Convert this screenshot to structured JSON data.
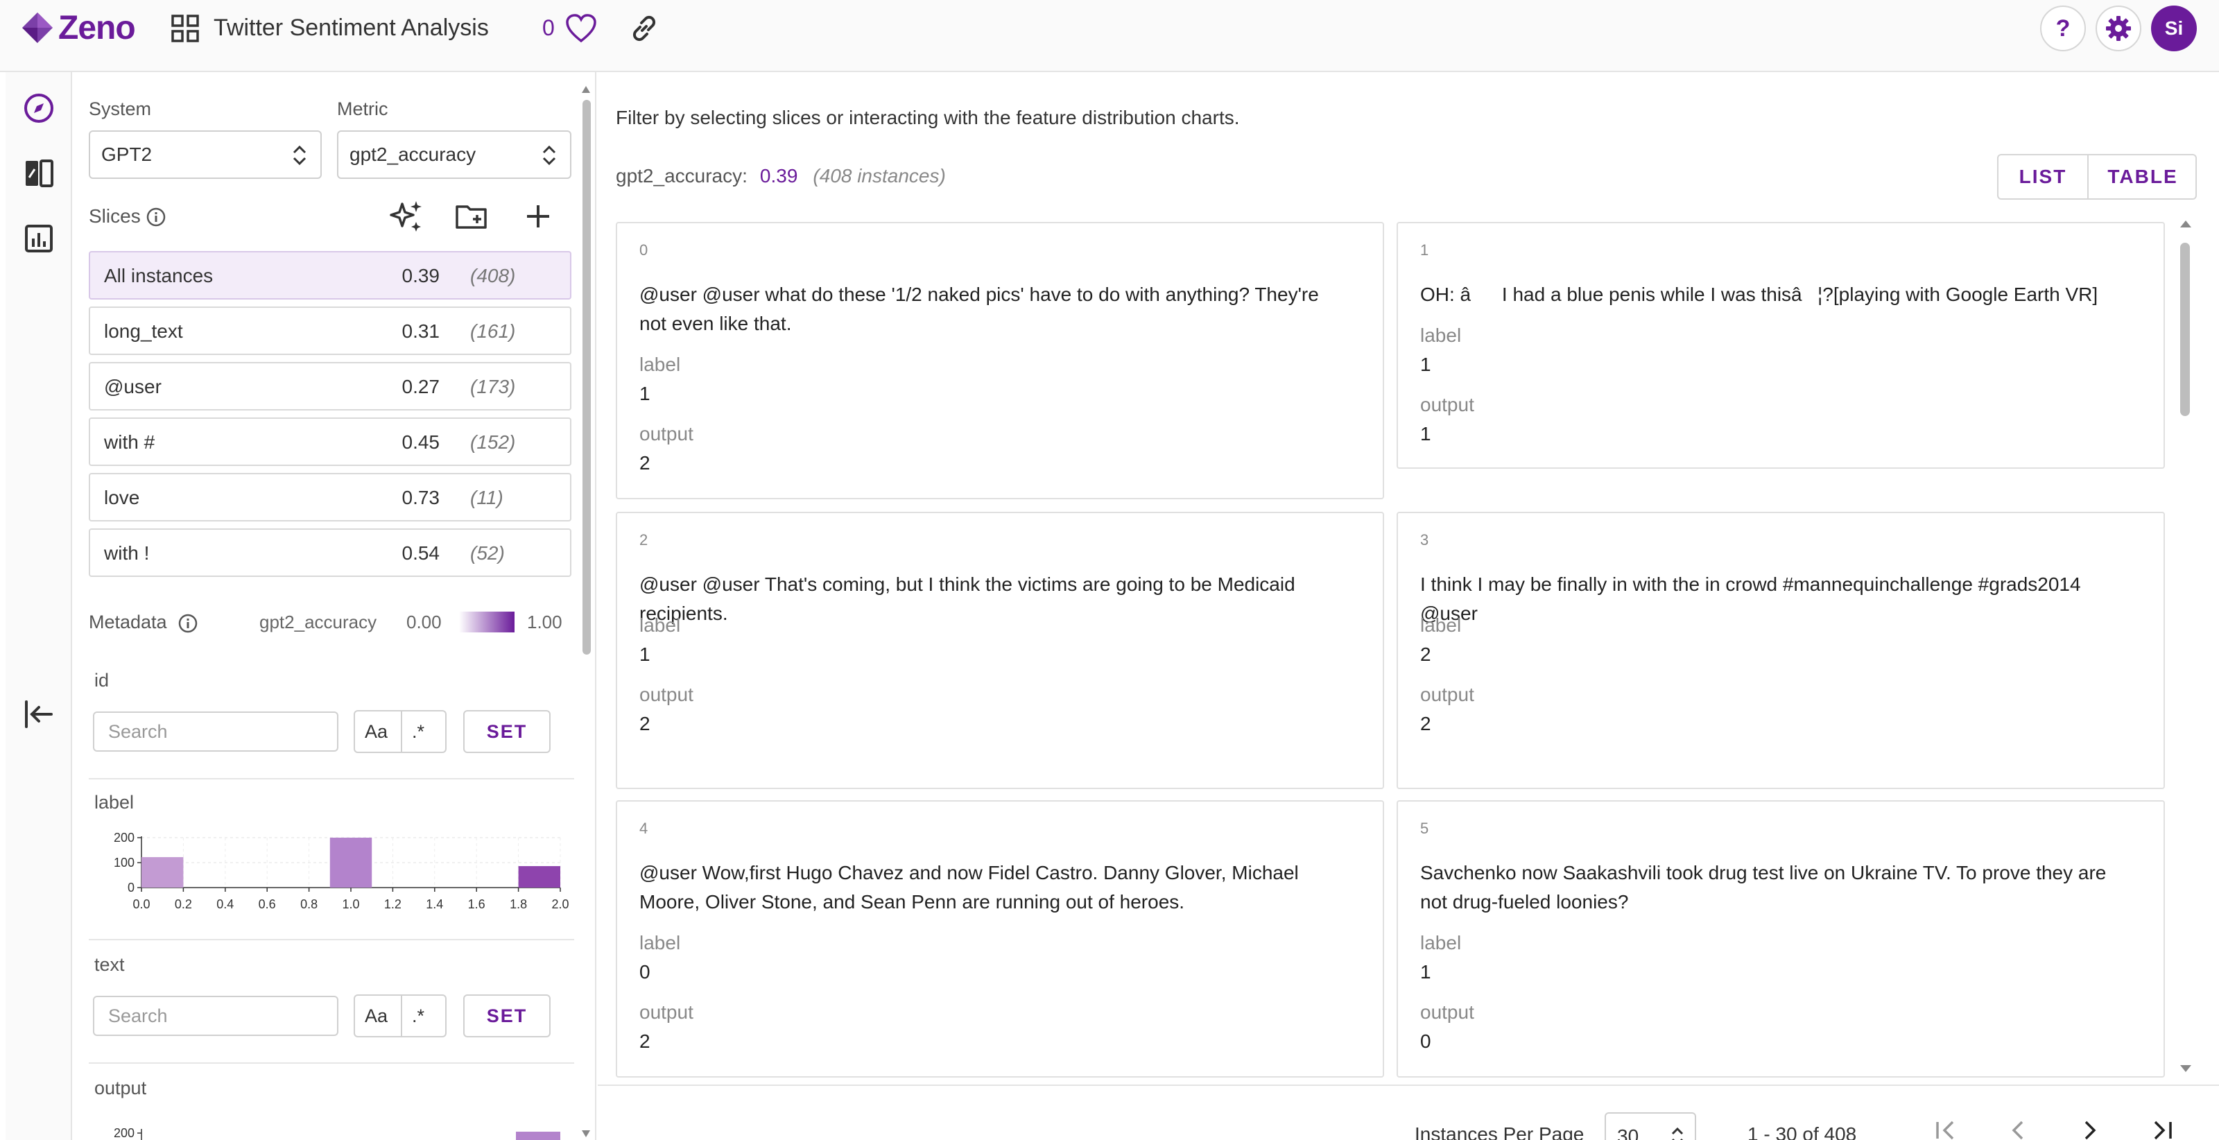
{
  "header": {
    "logo_text": "Zeno",
    "project_title": "Twitter Sentiment Analysis",
    "favorites_count": "0",
    "avatar_initials": "Si",
    "help_label": "?"
  },
  "sidebar": {
    "system_label": "System",
    "system_value": "GPT2",
    "metric_label": "Metric",
    "metric_value": "gpt2_accuracy",
    "slices_label": "Slices",
    "slices": [
      {
        "name": "All instances",
        "value": "0.39",
        "count": "(408)"
      },
      {
        "name": "long_text",
        "value": "0.31",
        "count": "(161)"
      },
      {
        "name": "@user",
        "value": "0.27",
        "count": "(173)"
      },
      {
        "name": "with #",
        "value": "0.45",
        "count": "(152)"
      },
      {
        "name": "love",
        "value": "0.73",
        "count": "(11)"
      },
      {
        "name": "with !",
        "value": "0.54",
        "count": "(52)"
      }
    ],
    "metadata_label": "Metadata",
    "legend_metric": "gpt2_accuracy",
    "legend_min": "0.00",
    "legend_max": "1.00",
    "features": [
      {
        "name": "id",
        "search_placeholder": "Search",
        "case_label": "Aa",
        "regex_label": ".*",
        "set_label": "SET"
      },
      {
        "name": "label"
      },
      {
        "name": "text",
        "search_placeholder": "Search",
        "case_label": "Aa",
        "regex_label": ".*",
        "set_label": "SET"
      },
      {
        "name": "output"
      }
    ]
  },
  "chart_data": {
    "type": "bar",
    "title": "label",
    "x_ticks": [
      "0.0",
      "0.2",
      "0.4",
      "0.6",
      "0.8",
      "1.0",
      "1.2",
      "1.4",
      "1.6",
      "1.8",
      "2.0"
    ],
    "y_ticks": [
      "0",
      "100",
      "200"
    ],
    "xlim": [
      0,
      2
    ],
    "ylim": [
      0,
      200
    ],
    "bins": [
      {
        "x0": 0.0,
        "x1": 0.2,
        "value": 122
      },
      {
        "x0": 0.9,
        "x1": 1.1,
        "value": 200
      },
      {
        "x0": 1.8,
        "x1": 2.0,
        "value": 86
      }
    ],
    "colors": [
      "#c39bd3",
      "#b383cc",
      "#8e44ad"
    ]
  },
  "output_chart": {
    "title": "output",
    "y_ticks": [
      "200"
    ]
  },
  "main": {
    "hint": "Filter by selecting slices or interacting with the feature distribution charts.",
    "metric_name": "gpt2_accuracy:",
    "metric_value": "0.39",
    "metric_count": "(408 instances)",
    "view_list": "LIST",
    "view_table": "TABLE",
    "cards": [
      {
        "id": "0",
        "text": "@user @user what do these '1/2 naked pics' have to do with anything? They're not even like that.",
        "label_key": "label",
        "label": "1",
        "output_key": "output",
        "output": "2"
      },
      {
        "id": "1",
        "text": "OH: âI had a blue penis while I was thisâ¦?[playing with Google Earth VR]",
        "label_key": "label",
        "label": "1",
        "output_key": "output",
        "output": "1"
      },
      {
        "id": "2",
        "text": "@user @user That's coming, but I think the victims are going to be Medicaid recipients.",
        "label_key": "label",
        "label": "1",
        "output_key": "output",
        "output": "2"
      },
      {
        "id": "3",
        "text": "I think I may be finally in with the in crowd #mannequinchallenge  #grads2014 @user",
        "label_key": "label",
        "label": "2",
        "output_key": "output",
        "output": "2"
      },
      {
        "id": "4",
        "text": "@user Wow,first Hugo Chavez and now Fidel Castro. Danny Glover, Michael Moore, Oliver Stone, and Sean Penn are running out of heroes.",
        "label_key": "label",
        "label": "0",
        "output_key": "output",
        "output": "2"
      },
      {
        "id": "5",
        "text": "Savchenko now Saakashvili took drug test live on Ukraine TV. To prove they are not drug-fueled loonies?",
        "label_key": "label",
        "label": "1",
        "output_key": "output",
        "output": "0"
      }
    ],
    "footer": {
      "per_page_label": "Instances Per Page",
      "per_page_value": "30",
      "range": "1 - 30 of 408"
    }
  },
  "colors": {
    "accent": "#6a1b9a",
    "selected_slice_bg": "#f3ecf9"
  }
}
